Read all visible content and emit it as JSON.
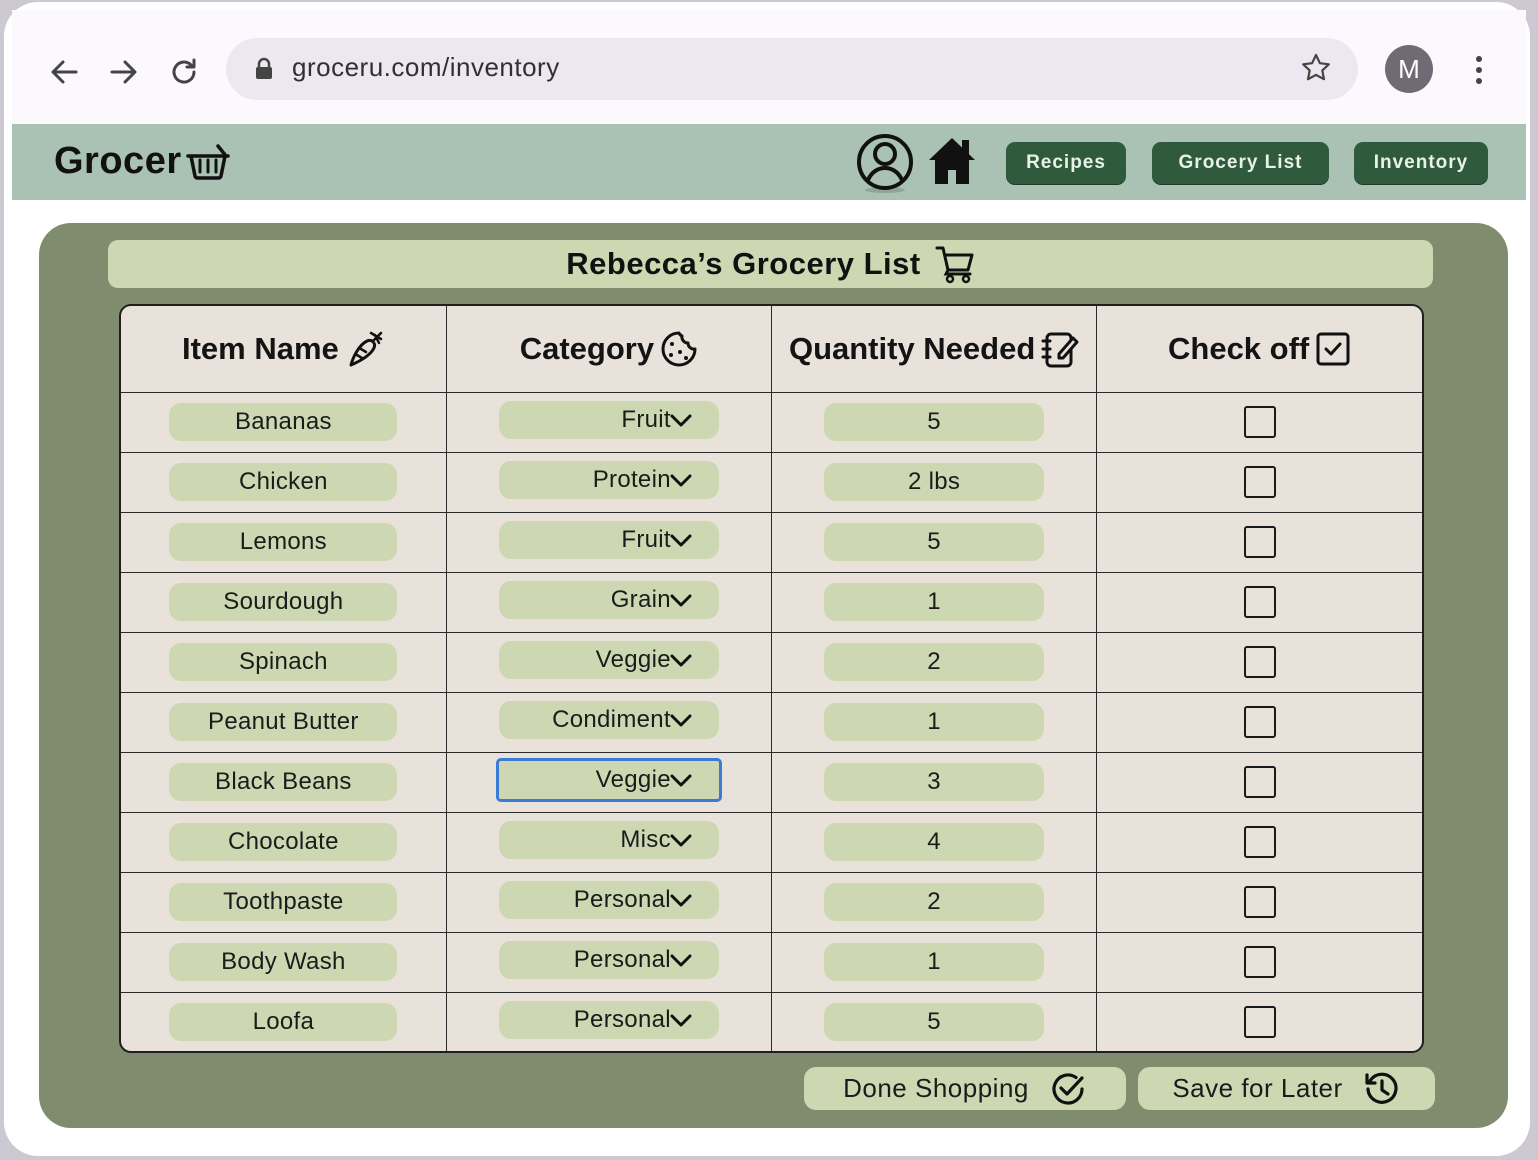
{
  "browser": {
    "url": "groceru.com/inventory",
    "profile_initial": "M",
    "icons": [
      "back-arrow-icon",
      "forward-arrow-icon",
      "reload-icon",
      "lock-icon",
      "star-icon",
      "kebab-menu-icon"
    ]
  },
  "app": {
    "logo_text": "Grocer",
    "logo_icon": "basket-icon",
    "nav": [
      {
        "label": "Recipes"
      },
      {
        "label": "Grocery List"
      },
      {
        "label": "Inventory"
      }
    ],
    "header_icons": [
      "user-profile-icon",
      "home-icon"
    ]
  },
  "list": {
    "title": "Rebecca’s Grocery List",
    "title_icon": "shopping-cart-icon",
    "columns": [
      {
        "label": "Item Name",
        "icon": "carrot-icon"
      },
      {
        "label": "Category",
        "icon": "cookie-icon"
      },
      {
        "label": "Quantity Needed",
        "icon": "notepad-edit-icon"
      },
      {
        "label": "Check off",
        "icon": "checkbox-checked-icon"
      }
    ],
    "rows": [
      {
        "name": "Bananas",
        "category": "Fruit",
        "quantity": "5",
        "checked": false
      },
      {
        "name": "Chicken",
        "category": "Protein",
        "quantity": "2 lbs",
        "checked": false
      },
      {
        "name": "Lemons",
        "category": "Fruit",
        "quantity": "5",
        "checked": false
      },
      {
        "name": "Sourdough",
        "category": "Grain",
        "quantity": "1",
        "checked": false
      },
      {
        "name": "Spinach",
        "category": "Veggie",
        "quantity": "2",
        "checked": false
      },
      {
        "name": "Peanut Butter",
        "category": "Condiment",
        "quantity": "1",
        "checked": false
      },
      {
        "name": "Black Beans",
        "category": "Veggie",
        "quantity": "3",
        "checked": false,
        "selected": true
      },
      {
        "name": "Chocolate",
        "category": "Misc",
        "quantity": "4",
        "checked": false
      },
      {
        "name": "Toothpaste",
        "category": "Personal",
        "quantity": "2",
        "checked": false
      },
      {
        "name": "Body Wash",
        "category": "Personal",
        "quantity": "1",
        "checked": false
      },
      {
        "name": "Loofa",
        "category": "Personal",
        "quantity": "5",
        "checked": false
      }
    ]
  },
  "actions": {
    "done_label": "Done Shopping",
    "save_label": "Save for Later"
  },
  "colors": {
    "header_bg": "#a9c2b4",
    "nav_pill": "#2f5b3c",
    "panel_bg": "#7f8d6e",
    "pill_bg": "#cdd8b3",
    "table_bg": "#e8e2da",
    "selection_outline": "#3a7bd5"
  }
}
